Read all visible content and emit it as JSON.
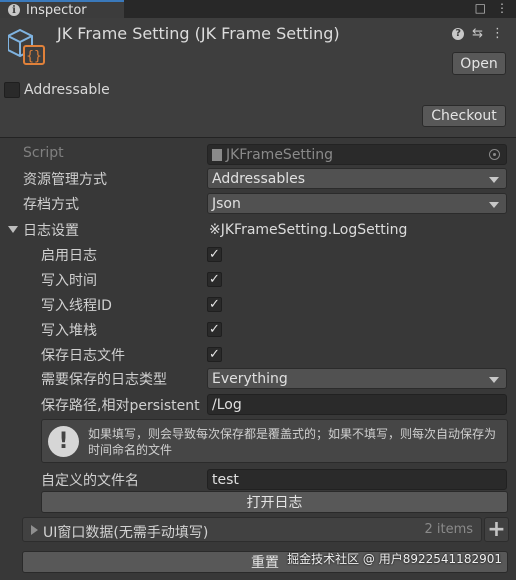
{
  "tab": {
    "title": "Inspector"
  },
  "header": {
    "title": "JK Frame Setting (JK Frame Setting)",
    "open_label": "Open",
    "addressable_label": "Addressable",
    "checkout_label": "Checkout",
    "tools_icons": [
      "help-icon",
      "preset-icon",
      "more-icon"
    ]
  },
  "fields": {
    "script": {
      "label": "Script",
      "value": "JKFrameSetting"
    },
    "resource_mode": {
      "label": "资源管理方式",
      "value": "Addressables"
    },
    "save_mode": {
      "label": "存档方式",
      "value": "Json"
    },
    "log_setting": {
      "label": "日志设置",
      "value": "※JKFrameSetting.LogSetting"
    },
    "enable_log": {
      "label": "启用日志",
      "checked": true
    },
    "write_time": {
      "label": "写入时间",
      "checked": true
    },
    "write_thread": {
      "label": "写入线程ID",
      "checked": true
    },
    "write_stack": {
      "label": "写入堆栈",
      "checked": true
    },
    "save_log_file": {
      "label": "保存日志文件",
      "checked": true
    },
    "save_log_types": {
      "label": "需要保存的日志类型",
      "value": "Everything"
    },
    "save_path": {
      "label": "保存路径,相对persistent",
      "value": "/Log"
    },
    "help_text": "如果填写，则会导致每次保存都是覆盖式的；如果不填写，则每次自动保存为时间命名的文件",
    "custom_file_name": {
      "label": "自定义的文件名",
      "value": "test"
    },
    "open_log_label": "打开日志",
    "ui_window_list": {
      "label": "UI窗口数据(无需手动填写)",
      "count": "2 items"
    },
    "reset_label": "重置"
  },
  "watermark": "掘金技术社区 @ 用户8922541182901",
  "colors": {
    "background": "#383838",
    "accent": "#3a79bb"
  }
}
